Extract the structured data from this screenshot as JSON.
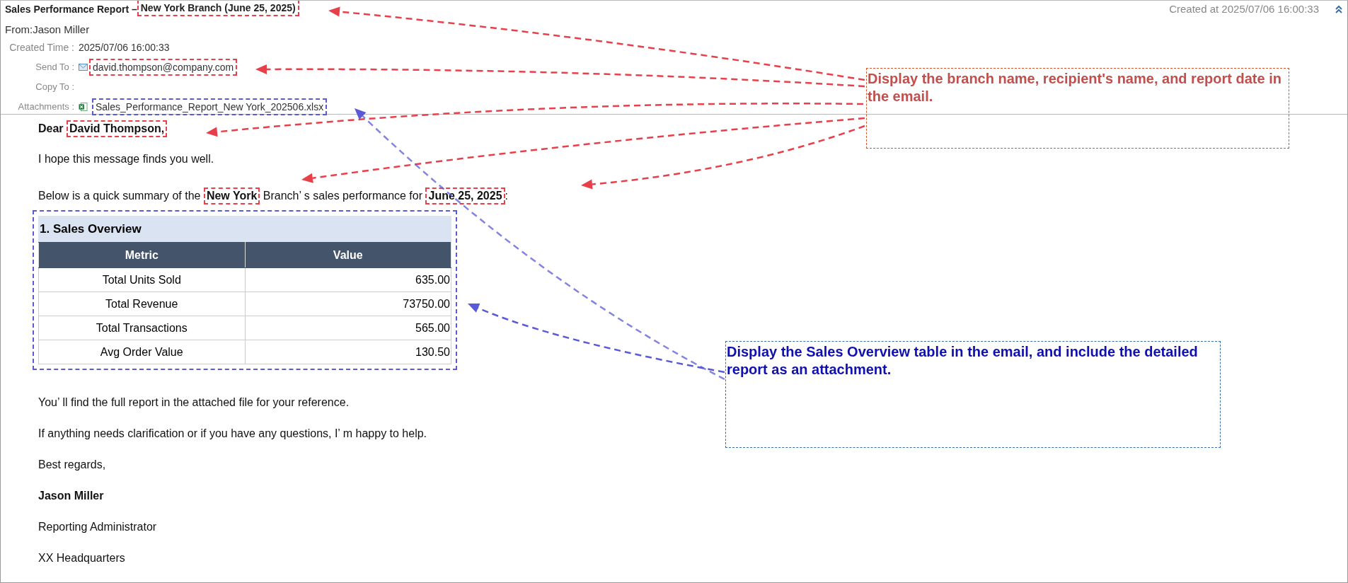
{
  "email": {
    "subject": [
      {
        "text": "Sales Performance Report – ",
        "highlight": false
      },
      {
        "text": "New York Branch (June 25, 2025)",
        "highlight": true
      }
    ],
    "created_at": "Created at 2025/07/06 16:00:33",
    "from": "From:Jason Miller",
    "fields": [
      {
        "kind": "text",
        "label": "Created Time :",
        "value": "2025/07/06 16:00:33",
        "highlight": false
      },
      {
        "kind": "recipient",
        "label": "Send To :",
        "value": "david.thompson@company.com",
        "highlight": true
      },
      {
        "kind": "empty",
        "label": "Copy To :"
      },
      {
        "kind": "attachment",
        "label": "Attachments :",
        "value": "Sales_Performance_Report_New York_202506.xlsx",
        "highlight": true
      }
    ]
  },
  "body": {
    "paragraphs_before": [
      {
        "bold": true,
        "segments": [
          {
            "text": "Dear ",
            "highlight": false
          },
          {
            "text": "David Thompson,",
            "highlight": true
          }
        ]
      },
      {
        "bold": false,
        "segments": [
          {
            "text": "I hope this message finds you well.",
            "highlight": false
          }
        ]
      },
      {
        "bold": false,
        "segments": [
          {
            "text": "Below is a quick summary of the ",
            "highlight": false
          },
          {
            "text": "**New York**",
            "highlight": true
          },
          {
            "text": " Branch’ s sales performance for ",
            "highlight": false
          },
          {
            "text": "**June 25, 2025**",
            "highlight": true
          },
          {
            "text": ":",
            "highlight": false
          }
        ]
      }
    ],
    "table": {
      "title": "1. Sales Overview",
      "highlight": true,
      "columns": [
        "Metric",
        "Value"
      ],
      "rows": [
        [
          "Total Units Sold",
          "635.00"
        ],
        [
          "Total Revenue",
          "73750.00"
        ],
        [
          "Total Transactions",
          "565.00"
        ],
        [
          "Avg Order Value",
          "130.50"
        ]
      ]
    },
    "paragraphs_after": [
      {
        "bold": false,
        "segments": [
          {
            "text": "You’ ll find the full report in the attached file for your reference.",
            "highlight": false
          }
        ]
      },
      {
        "bold": false,
        "segments": [
          {
            "text": "If anything needs clarification or if you have any questions, I’ m happy to help.",
            "highlight": false
          }
        ]
      },
      {
        "bold": false,
        "segments": [
          {
            "text": "Best regards,",
            "highlight": false
          }
        ]
      },
      {
        "bold": true,
        "segments": [
          {
            "text": "Jason Miller",
            "highlight": false
          }
        ]
      },
      {
        "bold": false,
        "segments": [
          {
            "text": "Reporting Administrator",
            "highlight": false
          }
        ]
      },
      {
        "bold": false,
        "segments": [
          {
            "text": "XX Headquarters",
            "highlight": false
          }
        ]
      }
    ]
  },
  "annotations": [
    {
      "text": "Display the branch name, recipient's name, and report date in the email.",
      "color": "#c0504d"
    },
    {
      "text": "Display the Sales Overview table in the email, and include the detailed report as an attachment.",
      "color": "#1010b0"
    }
  ]
}
